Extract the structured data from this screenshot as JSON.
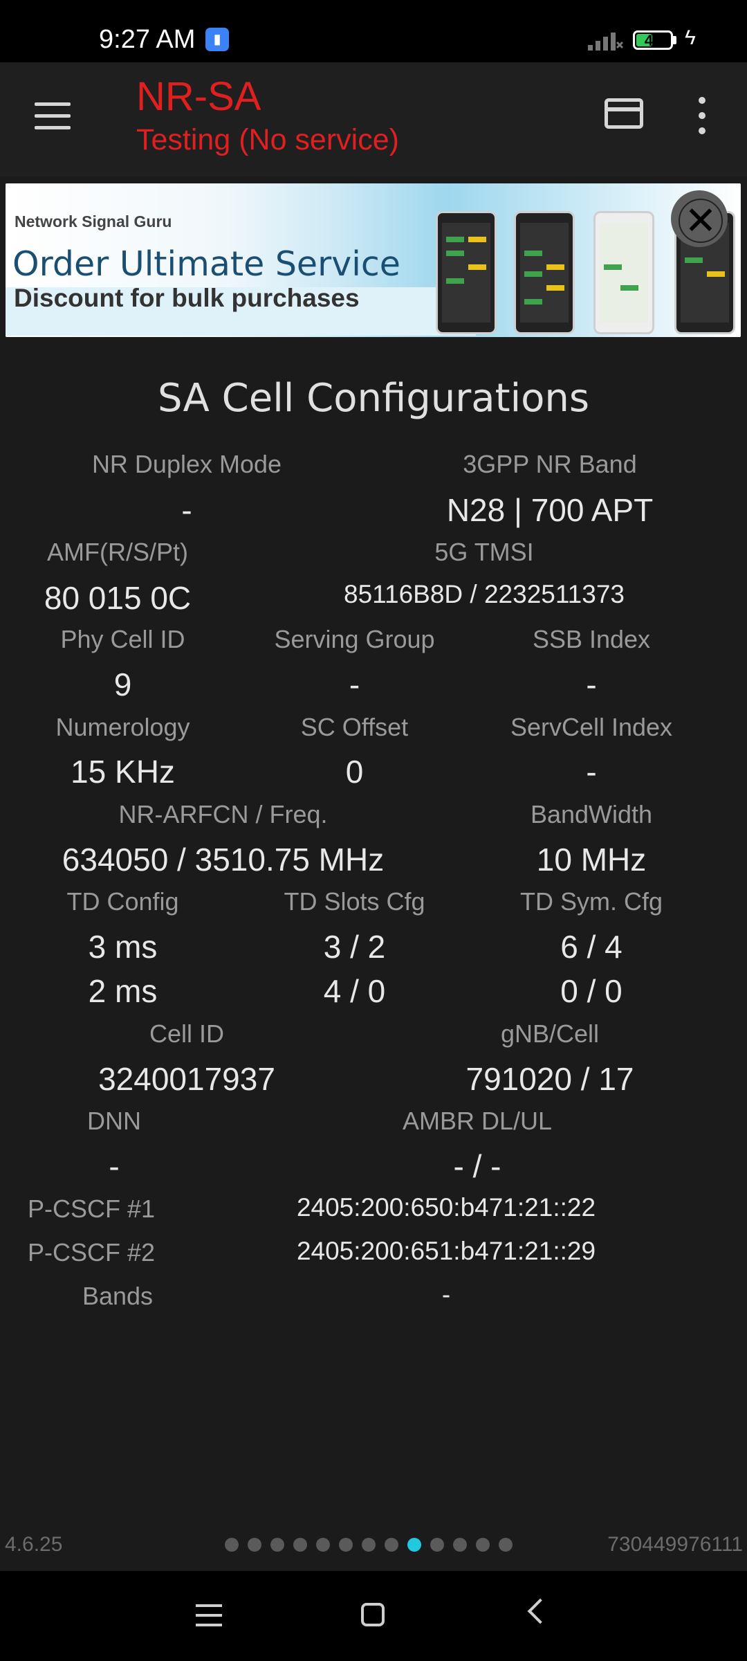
{
  "status_bar": {
    "time": "9:27 AM",
    "battery_level": "48",
    "battery_percent": 48
  },
  "app_bar": {
    "title": "NR-SA",
    "subtitle": "Testing (No service)"
  },
  "ad": {
    "brand": "Network Signal Guru",
    "headline": "Order Ultimate Service",
    "subheadline": "Discount for bulk purchases"
  },
  "section_title": "SA Cell Configurations",
  "fields": {
    "duplex_mode": {
      "label": "NR Duplex Mode",
      "value": "-"
    },
    "nr_band": {
      "label": "3GPP NR Band",
      "value": "N28 | 700 APT"
    },
    "amf": {
      "label": "AMF(R/S/Pt)",
      "value": "80 015 0C"
    },
    "tmsi": {
      "label": "5G TMSI",
      "value": "85116B8D / 2232511373"
    },
    "phy_cell_id": {
      "label": "Phy Cell ID",
      "value": "9"
    },
    "serving_group": {
      "label": "Serving Group",
      "value": "-"
    },
    "ssb_index": {
      "label": "SSB Index",
      "value": "-"
    },
    "numerology": {
      "label": "Numerology",
      "value": "15 KHz"
    },
    "sc_offset": {
      "label": "SC Offset",
      "value": "0"
    },
    "servcell_index": {
      "label": "ServCell Index",
      "value": "-"
    },
    "arfcn": {
      "label": "NR-ARFCN / Freq.",
      "value": "634050 / 3510.75 MHz"
    },
    "bandwidth": {
      "label": "BandWidth",
      "value": "10 MHz"
    },
    "td_config": {
      "label": "TD Config",
      "values": [
        "3 ms",
        "2 ms"
      ]
    },
    "td_slots": {
      "label": "TD Slots Cfg",
      "values": [
        "3 / 2",
        "4 / 0"
      ]
    },
    "td_sym": {
      "label": "TD Sym. Cfg",
      "values": [
        "6 / 4",
        "0 / 0"
      ]
    },
    "cell_id": {
      "label": "Cell ID",
      "value": "3240017937"
    },
    "gnb_cell": {
      "label": "gNB/Cell",
      "value": "791020 / 17"
    },
    "dnn": {
      "label": "DNN",
      "value": "-"
    },
    "ambr": {
      "label": "AMBR DL/UL",
      "value": "- / -"
    },
    "pcscf1": {
      "label": "P-CSCF #1",
      "value": "2405:200:650:b471:21::22"
    },
    "pcscf2": {
      "label": "P-CSCF #2",
      "value": "2405:200:651:b471:21::29"
    },
    "bands": {
      "label": "Bands",
      "value": "-"
    }
  },
  "footer": {
    "version": "4.6.25",
    "device_id": "730449976111",
    "page_count": 13,
    "active_page": 9
  },
  "colors": {
    "accent_red": "#e02020",
    "active_dot": "#22c7e0"
  }
}
